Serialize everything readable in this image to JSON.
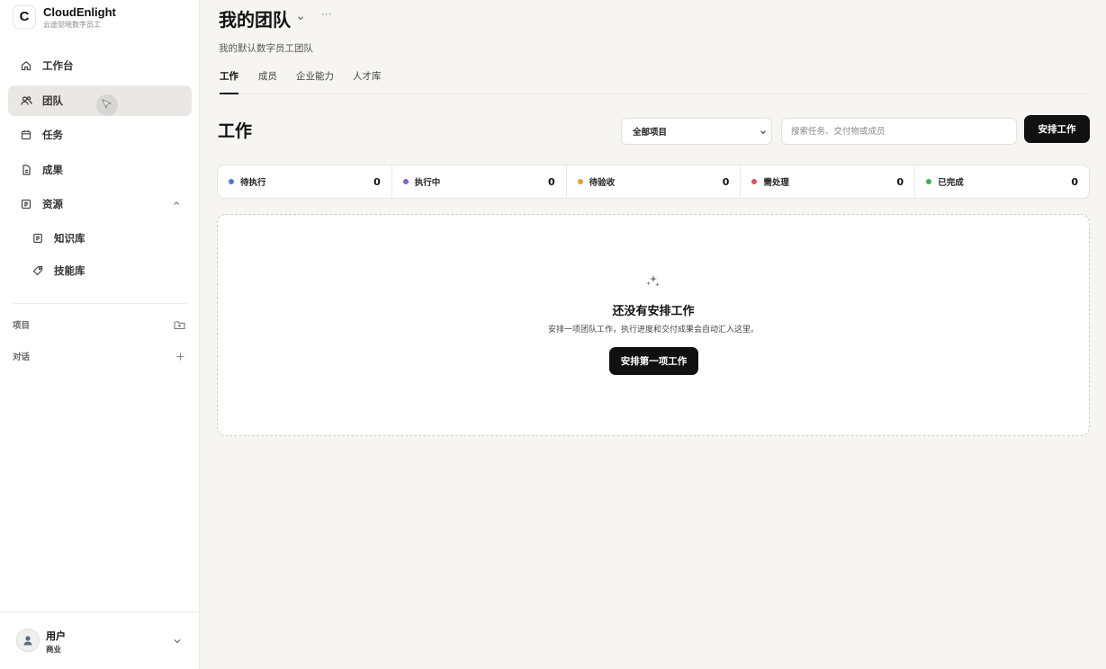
{
  "brand": {
    "name": "CloudEnlight",
    "subtitle": "云途觉晓数字员工",
    "logo": "C"
  },
  "sidebar": {
    "items": [
      {
        "label": "工作台",
        "icon": "home-icon"
      },
      {
        "label": "团队",
        "icon": "users-icon",
        "active": true
      },
      {
        "label": "任务",
        "icon": "calendar-icon"
      },
      {
        "label": "成果",
        "icon": "document-icon"
      },
      {
        "label": "资源",
        "icon": "list-icon",
        "expanded": true,
        "children": [
          {
            "label": "知识库",
            "icon": "book-icon"
          },
          {
            "label": "技能库",
            "icon": "tag-icon"
          }
        ]
      }
    ],
    "sections": [
      {
        "label": "项目",
        "action_icon": "folder-plus-icon"
      },
      {
        "label": "对话",
        "action_icon": "plus-icon"
      }
    ]
  },
  "user": {
    "name": "用户",
    "plan": "商业"
  },
  "header": {
    "title": "我的团队",
    "more": "···",
    "description": "我的默认数字员工团队",
    "tabs": [
      {
        "label": "工作",
        "active": true
      },
      {
        "label": "成员"
      },
      {
        "label": "企业能力"
      },
      {
        "label": "人才库"
      }
    ]
  },
  "work": {
    "title": "工作",
    "project_filter": "全部项目",
    "search_placeholder": "搜索任务、交付物或成员",
    "primary_action": "安排工作",
    "statuses": [
      {
        "label": "待执行",
        "count": "0",
        "color": "#4a7be0"
      },
      {
        "label": "执行中",
        "count": "0",
        "color": "#7b63d8"
      },
      {
        "label": "待验收",
        "count": "0",
        "color": "#e0a12e"
      },
      {
        "label": "需处理",
        "count": "0",
        "color": "#e05060"
      },
      {
        "label": "已完成",
        "count": "0",
        "color": "#3fae5a"
      }
    ],
    "empty": {
      "icon": "sparkle-icon",
      "title": "还没有安排工作",
      "description": "安排一项团队工作，执行进度和交付成果会自动汇入这里。",
      "button": "安排第一项工作"
    }
  }
}
